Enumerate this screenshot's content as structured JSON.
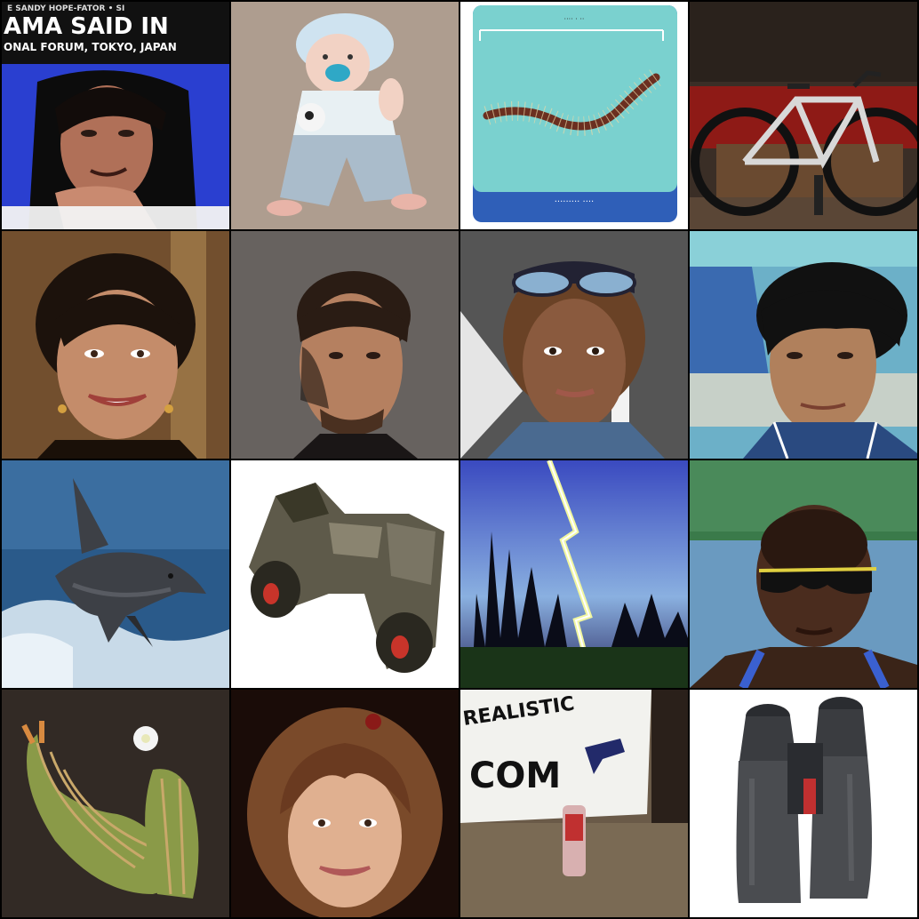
{
  "grid": {
    "rows": 4,
    "columns": 4
  },
  "tiles": [
    {
      "subject": "man-poster",
      "text_top": "E SANDY HOPE-FATOR • SI",
      "text_main": "AMA SAID IN",
      "text_sub": "ONAL FORUM, TOKYO, JAPAN"
    },
    {
      "subject": "baby-with-ball"
    },
    {
      "subject": "centipede-card",
      "text_card_top": "···· · ··",
      "text_card_bottom": "········· ····"
    },
    {
      "subject": "bicycle-in-shop"
    },
    {
      "subject": "smiling-woman-earrings"
    },
    {
      "subject": "man-dark-background"
    },
    {
      "subject": "woman-sunglasses-on-head"
    },
    {
      "subject": "young-man-portrait"
    },
    {
      "subject": "dolphin-jumping"
    },
    {
      "subject": "compact-binoculars"
    },
    {
      "subject": "lightning-over-forest"
    },
    {
      "subject": "athlete-sunglasses"
    },
    {
      "subject": "cactus-flower"
    },
    {
      "subject": "woman-long-hair"
    },
    {
      "subject": "sign-and-can",
      "text_sign_1": "REALISTIC",
      "text_sign_2": "COM"
    },
    {
      "subject": "large-binoculars"
    }
  ],
  "colors": {
    "border": "#000000",
    "poster_blue": "#2a3fd0",
    "card_teal": "#7ad1cf",
    "card_blue": "#2f5fb8"
  }
}
